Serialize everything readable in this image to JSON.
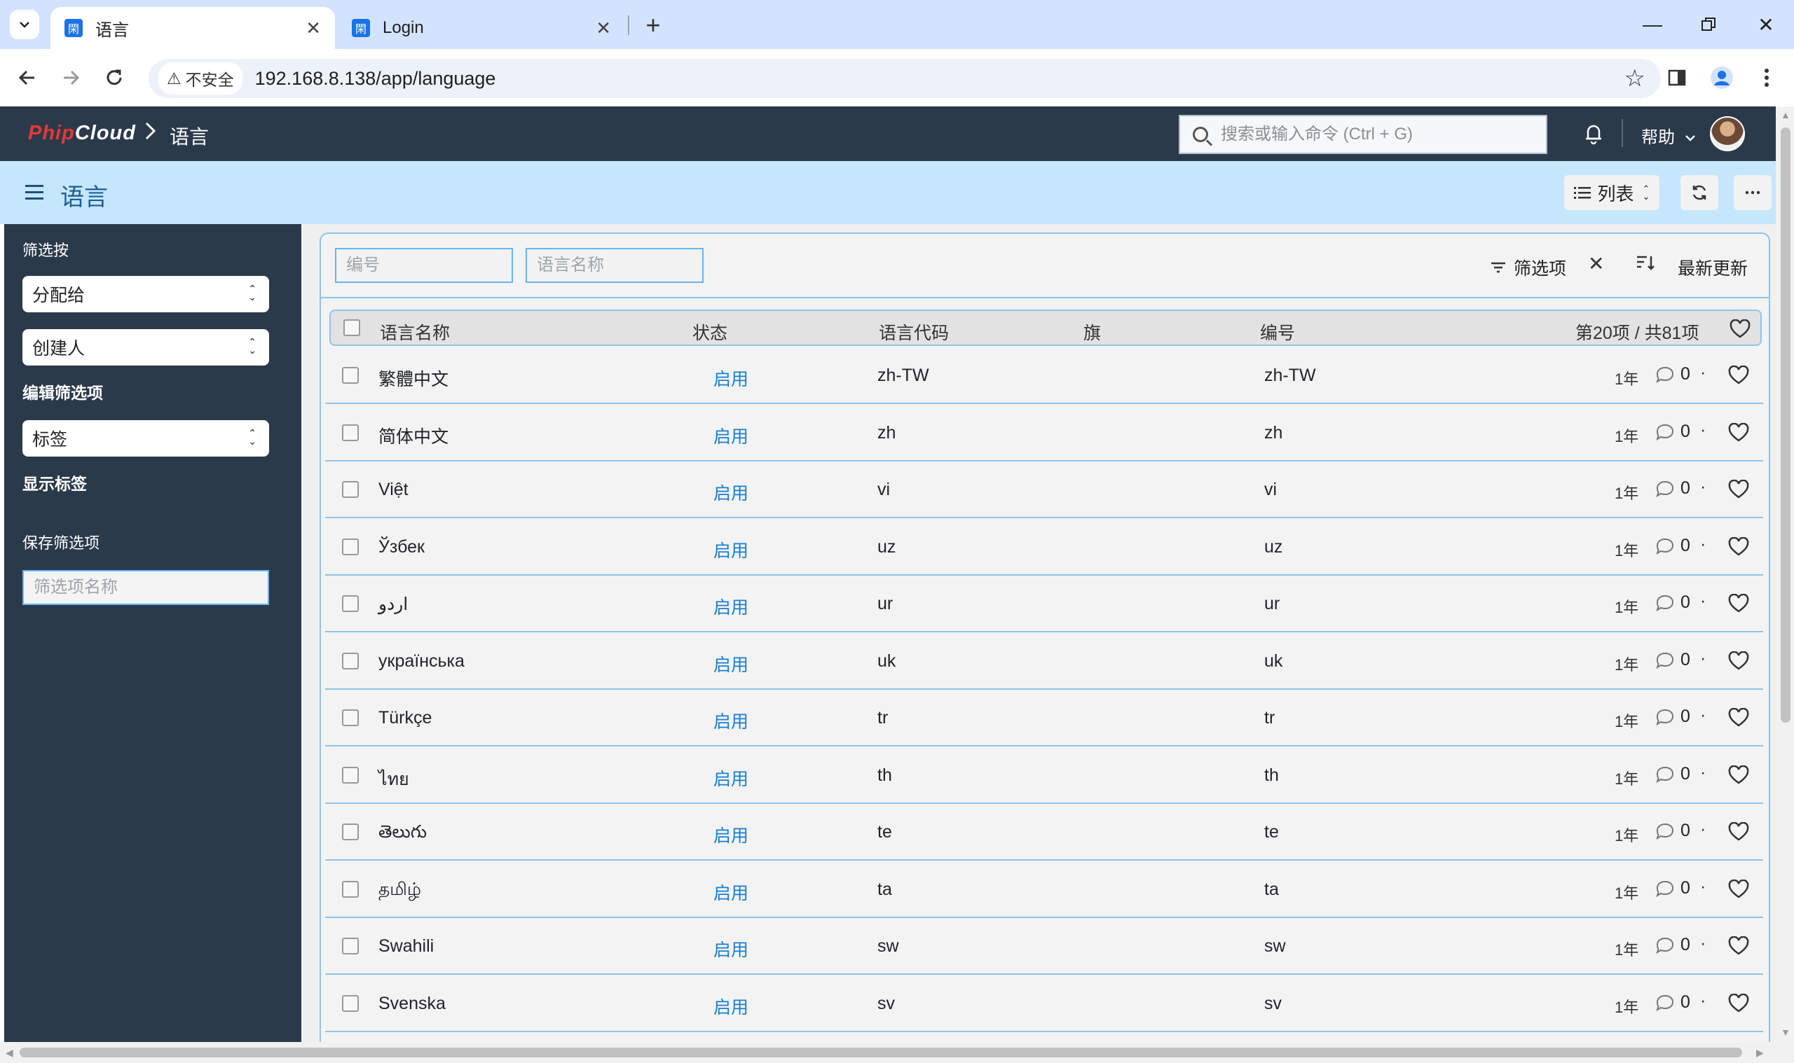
{
  "browser": {
    "tabs": [
      {
        "title": "语言",
        "active": true
      },
      {
        "title": "Login",
        "active": false
      }
    ],
    "security_label": "不安全",
    "url": "192.168.8.138/app/language"
  },
  "app": {
    "logo_part1": "Phip",
    "logo_part2": "Cloud",
    "breadcrumb": "语言",
    "search_placeholder": "搜索或输入命令 (Ctrl + G)",
    "help_label": "帮助"
  },
  "page": {
    "title": "语言",
    "view_label": "列表"
  },
  "sidebar": {
    "filter_by_label": "筛选按",
    "assigned_to": "分配给",
    "created_by": "创建人",
    "edit_filters": "编辑筛选项",
    "tags": "标签",
    "show_tags": "显示标签",
    "save_filter_label": "保存筛选项",
    "filter_name_placeholder": "筛选项名称"
  },
  "filters": {
    "id_placeholder": "编号",
    "name_placeholder": "语言名称",
    "filter_label": "筛选项",
    "sort_label": "最新更新"
  },
  "table": {
    "headers": {
      "name": "语言名称",
      "status": "状态",
      "code": "语言代码",
      "flag": "旗",
      "id": "编号",
      "count": "第20项 / 共81项"
    },
    "rows": [
      {
        "name": "繁體中文",
        "status": "启用",
        "code": "zh-TW",
        "id": "zh-TW",
        "age": "1年",
        "comments": "0"
      },
      {
        "name": "简体中文",
        "status": "启用",
        "code": "zh",
        "id": "zh",
        "age": "1年",
        "comments": "0"
      },
      {
        "name": "Việt",
        "status": "启用",
        "code": "vi",
        "id": "vi",
        "age": "1年",
        "comments": "0"
      },
      {
        "name": "Ўзбек",
        "status": "启用",
        "code": "uz",
        "id": "uz",
        "age": "1年",
        "comments": "0"
      },
      {
        "name": "اردو",
        "status": "启用",
        "code": "ur",
        "id": "ur",
        "age": "1年",
        "comments": "0"
      },
      {
        "name": "українська",
        "status": "启用",
        "code": "uk",
        "id": "uk",
        "age": "1年",
        "comments": "0"
      },
      {
        "name": "Türkçe",
        "status": "启用",
        "code": "tr",
        "id": "tr",
        "age": "1年",
        "comments": "0"
      },
      {
        "name": "ไทย",
        "status": "启用",
        "code": "th",
        "id": "th",
        "age": "1年",
        "comments": "0"
      },
      {
        "name": "తెలుగు",
        "status": "启用",
        "code": "te",
        "id": "te",
        "age": "1年",
        "comments": "0"
      },
      {
        "name": "தமிழ்",
        "status": "启用",
        "code": "ta",
        "id": "ta",
        "age": "1年",
        "comments": "0"
      },
      {
        "name": "Swahili",
        "status": "启用",
        "code": "sw",
        "id": "sw",
        "age": "1年",
        "comments": "0"
      },
      {
        "name": "Svenska",
        "status": "启用",
        "code": "sv",
        "id": "sv",
        "age": "1年",
        "comments": "0"
      }
    ]
  },
  "colors": {
    "appbar": "#2b3a4b",
    "pagehead": "#c6e6fb",
    "status_link": "#1a7fd0",
    "tab_strip": "#d3e3fd"
  }
}
